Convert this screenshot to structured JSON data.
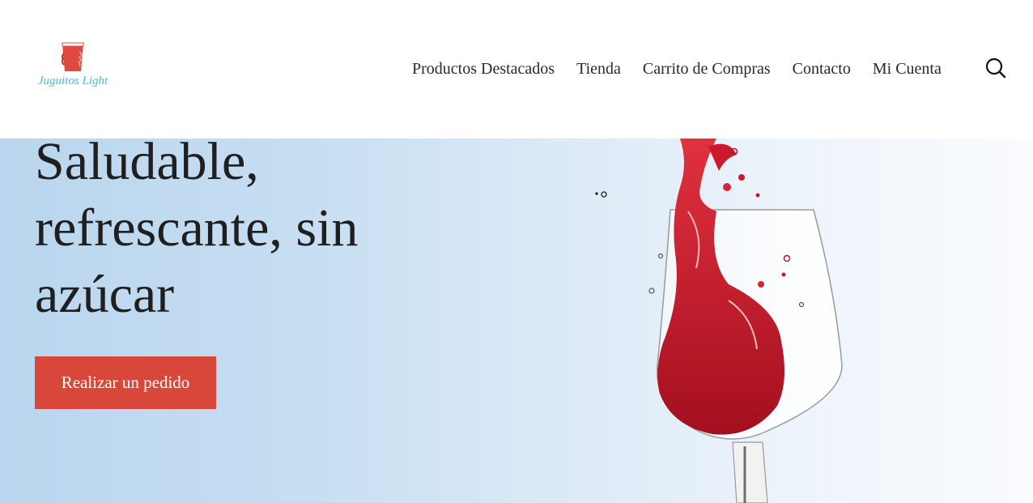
{
  "header": {
    "logo_text": "Juguitos Light",
    "nav": [
      {
        "label": "Productos Destacados"
      },
      {
        "label": "Tienda"
      },
      {
        "label": "Carrito de Compras"
      },
      {
        "label": "Contacto"
      },
      {
        "label": "Mi Cuenta"
      }
    ],
    "search_icon": "search-icon"
  },
  "hero": {
    "title": "Saludable, refrescante, sin azúcar",
    "cta_label": "Realizar un pedido",
    "image": "wine-glass-splash"
  },
  "colors": {
    "accent": "#d9473a",
    "logo_text": "#43bfd0",
    "hero_bg_left": "#b9d6ee",
    "hero_bg_right": "#fafcfe",
    "text": "#1f1f1f"
  }
}
